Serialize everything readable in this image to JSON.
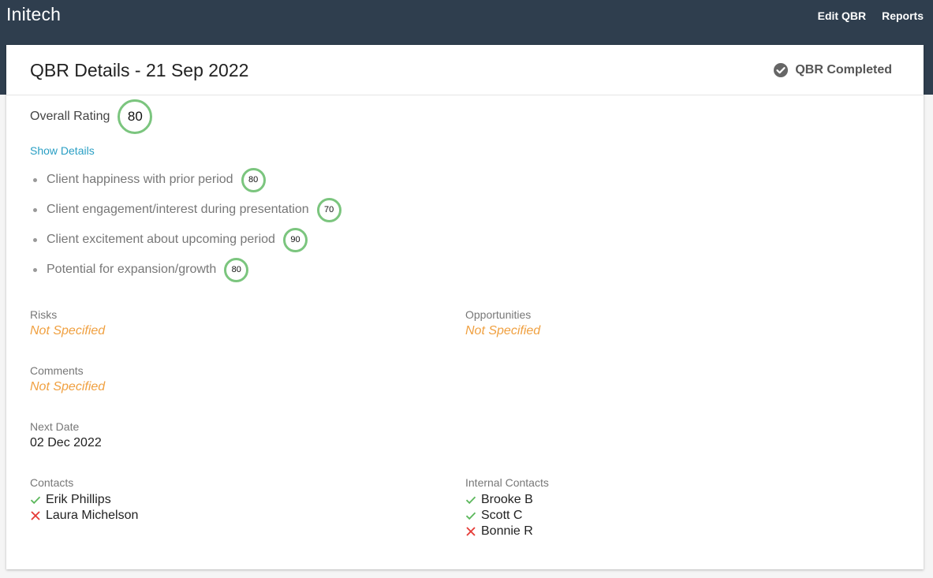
{
  "app": {
    "brand": "Initech"
  },
  "nav": {
    "edit_label": "Edit QBR",
    "reports_label": "Reports"
  },
  "card": {
    "title": "QBR Details - 21 Sep 2022",
    "status": "QBR Completed"
  },
  "rating": {
    "label": "Overall Rating",
    "value": "80",
    "show_details": "Show Details",
    "items": [
      {
        "label": "Client happiness with prior period",
        "value": "80"
      },
      {
        "label": "Client engagement/interest during presentation",
        "value": "70"
      },
      {
        "label": "Client excitement about upcoming period",
        "value": "90"
      },
      {
        "label": "Potential for expansion/growth",
        "value": "80"
      }
    ]
  },
  "fields": {
    "risks": {
      "label": "Risks",
      "value": "Not Specified"
    },
    "opportunities": {
      "label": "Opportunities",
      "value": "Not Specified"
    },
    "comments": {
      "label": "Comments",
      "value": "Not Specified"
    },
    "next_date": {
      "label": "Next Date",
      "value": "02 Dec 2022"
    }
  },
  "contacts": {
    "label": "Contacts",
    "items": [
      {
        "name": "Erik Phillips",
        "status": "check"
      },
      {
        "name": "Laura Michelson",
        "status": "cross"
      }
    ]
  },
  "internal_contacts": {
    "label": "Internal Contacts",
    "items": [
      {
        "name": "Brooke B",
        "status": "check"
      },
      {
        "name": "Scott C",
        "status": "check"
      },
      {
        "name": "Bonnie R",
        "status": "cross"
      }
    ]
  },
  "colors": {
    "header_bg": "#2f3e4e",
    "ring": "#7bc57e",
    "link": "#2a9fc4",
    "not_specified": "#f0a040",
    "check": "#5cb85c",
    "cross": "#e53935"
  }
}
